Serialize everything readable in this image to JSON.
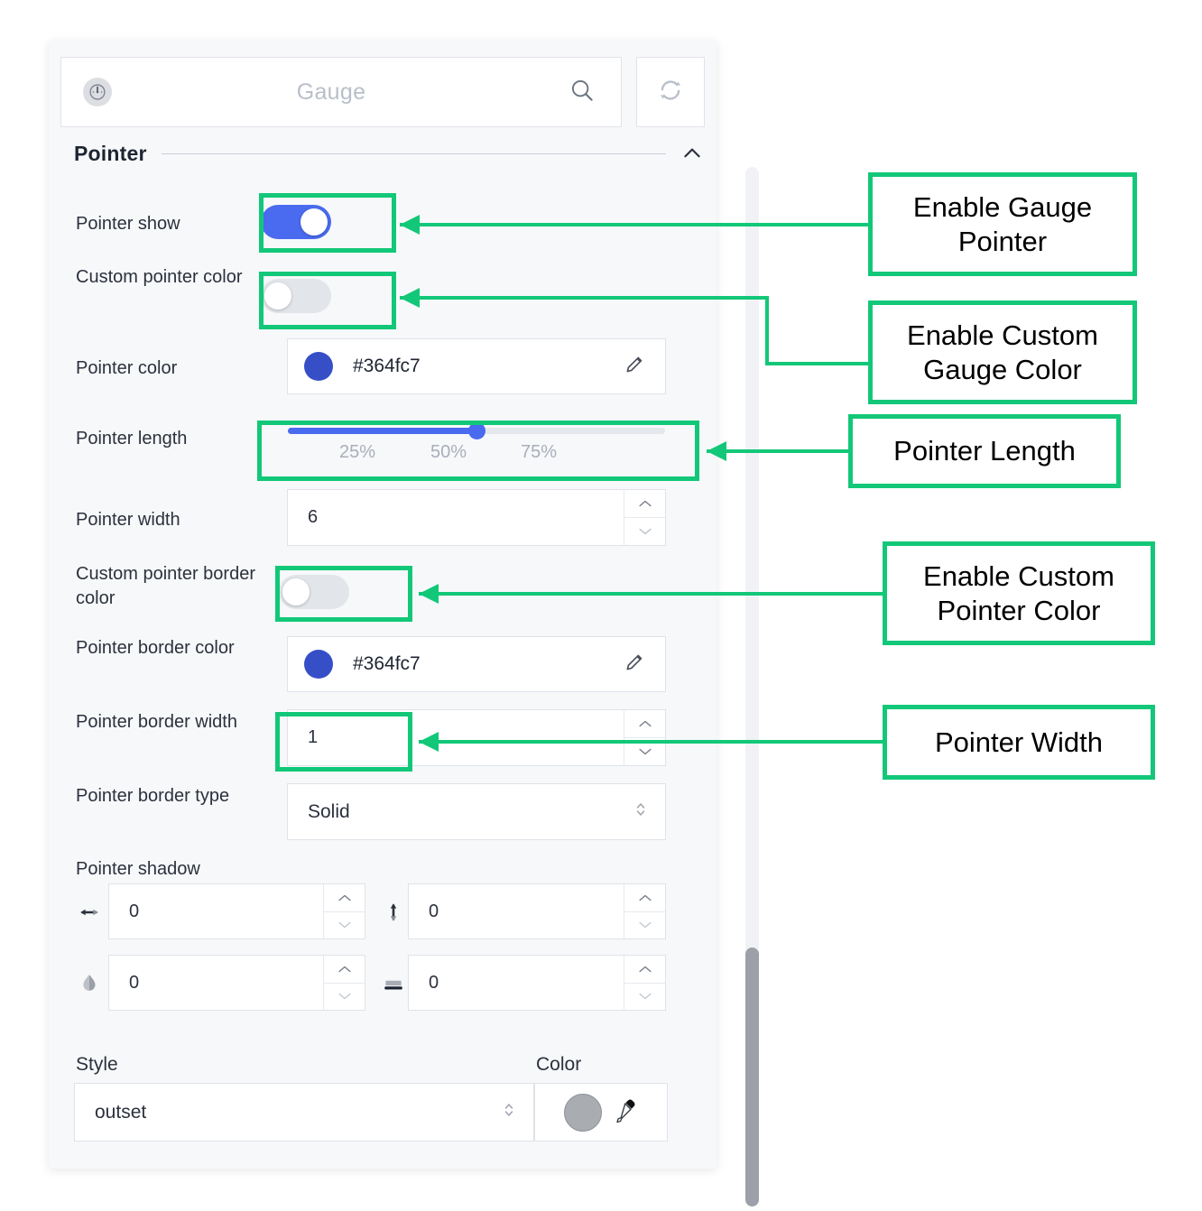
{
  "header": {
    "icon": "gauge-icon",
    "title": "Gauge",
    "search_icon": "search-icon",
    "reset_icon": "refresh-icon"
  },
  "section": {
    "title": "Pointer",
    "collapse_icon": "chevron-up-icon"
  },
  "fields": {
    "pointer_show": {
      "label": "Pointer show",
      "state": "on"
    },
    "custom_pointer_color": {
      "label": "Custom pointer color",
      "state": "off"
    },
    "pointer_color": {
      "label": "Pointer color",
      "value": "#364fc7",
      "swatch": "#364fc7",
      "edit_icon": "pencil-icon"
    },
    "pointer_length": {
      "label": "Pointer length",
      "ticks": [
        "25%",
        "50%",
        "75%"
      ],
      "percent": 50,
      "fill_color": "#4a6bef"
    },
    "pointer_width": {
      "label": "Pointer width",
      "value": "6"
    },
    "custom_pointer_border_color": {
      "label": "Custom pointer border color",
      "state": "off"
    },
    "pointer_border_color": {
      "label": "Pointer border color",
      "value": "#364fc7",
      "swatch": "#364fc7",
      "edit_icon": "pencil-icon"
    },
    "pointer_border_width": {
      "label": "Pointer border width",
      "value": "1"
    },
    "pointer_border_type": {
      "label": "Pointer border type",
      "value": "Solid"
    },
    "pointer_shadow": {
      "label": "Pointer shadow",
      "h_offset": {
        "icon": "horizontal-arrows-icon",
        "value": "0"
      },
      "v_offset": {
        "icon": "vertical-arrows-icon",
        "value": "0"
      },
      "blur": {
        "icon": "blur-drop-icon",
        "value": "0"
      },
      "spread": {
        "icon": "spread-bar-icon",
        "value": "0"
      }
    },
    "style": {
      "label": "Style",
      "value": "outset"
    },
    "shadow_color": {
      "label": "Color",
      "swatch": "#a9adb2",
      "picker_icon": "eyedropper-icon"
    }
  },
  "annotations": [
    {
      "text": "Enable Gauge Pointer"
    },
    {
      "text": "Enable Custom Gauge Color"
    },
    {
      "text": "Pointer Length"
    },
    {
      "text": "Enable Custom Pointer Color"
    },
    {
      "text": "Pointer Width"
    }
  ],
  "colors": {
    "accent_green": "#12c878",
    "accent_blue": "#4a6bef",
    "panel_bg": "#f7f8fa"
  }
}
